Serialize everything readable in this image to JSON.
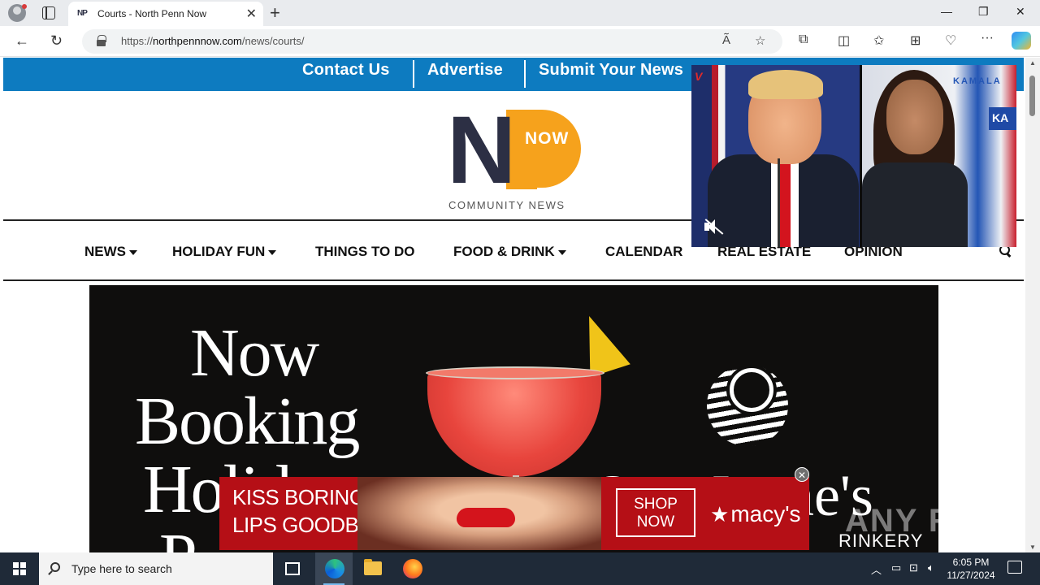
{
  "browser": {
    "tab_title": "Courts - North Penn Now",
    "favicon_text": "NP",
    "url_prefix": "https://",
    "url_host": "northpennnow.com",
    "url_path": "/news/courts/"
  },
  "site": {
    "top_links": [
      "Contact Us",
      "Advertise",
      "Submit Your News"
    ],
    "logo": {
      "letters_n": "N",
      "badge": "NOW",
      "tagline": "COMMUNITY NEWS"
    },
    "nav": [
      {
        "label": "NEWS",
        "dropdown": true
      },
      {
        "label": "HOLIDAY FUN",
        "dropdown": true
      },
      {
        "label": "THINGS TO DO",
        "dropdown": false
      },
      {
        "label": "FOOD & DRINK",
        "dropdown": true
      },
      {
        "label": "CALENDAR",
        "dropdown": false
      },
      {
        "label": "REAL ESTATE",
        "dropdown": false
      },
      {
        "label": "OPINION",
        "dropdown": false
      }
    ]
  },
  "hero_ad": {
    "line1": "Now",
    "line2": "Booking",
    "line3": "Holid",
    "line4": "P",
    "brand": "Ooo  Jayne's",
    "brand_sub": "RINKERY"
  },
  "banner_ad": {
    "line1": "KISS BORING",
    "line2": "LIPS GOODBYE",
    "cta_line1": "SHOP",
    "cta_line2": "NOW",
    "brand": "macy's",
    "close": "✕"
  },
  "video": {
    "logo": "V",
    "sign_text": "KAMALA",
    "sign_badge": "KA"
  },
  "watermark": "ANY RUN",
  "taskbar": {
    "search_placeholder": "Type here to search",
    "time": "6:05 PM",
    "date": "11/27/2024"
  },
  "colors": {
    "brand_blue": "#0d7bc0",
    "logo_navy": "#2c2f44",
    "logo_orange": "#f6a21c",
    "macys_red": "#b50f16"
  }
}
